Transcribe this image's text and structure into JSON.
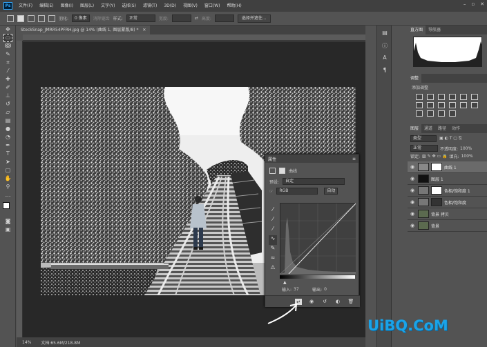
{
  "menubar": {
    "logo": "Ps",
    "items": [
      "文件(F)",
      "编辑(E)",
      "图像(I)",
      "图层(L)",
      "文字(Y)",
      "选择(S)",
      "滤镜(T)",
      "3D(D)",
      "视图(V)",
      "窗口(W)",
      "帮助(H)"
    ]
  },
  "options": {
    "feather_label": "羽化:",
    "feather_value": "0 像素",
    "antialias_label": "消除锯齿",
    "style_label": "样式:",
    "style_value": "正常",
    "width_label": "宽度:",
    "height_label": "高度:",
    "select_mask_button": "选择并遮住..."
  },
  "document": {
    "tab_title": "StockSnap_JMRR54PFRH.jpg @ 14% (曲线 1, 图层蒙版/8) *",
    "zoom": "14%",
    "doc_info": "文档:65.6M/218.8M"
  },
  "panels": {
    "top_tabs": [
      "直方图",
      "导航器"
    ],
    "adjust_tabs": [
      "调整"
    ],
    "adjust_hint": "添加调整",
    "layer_tabs": [
      "图层",
      "通道",
      "路径",
      "动作"
    ],
    "kind_label": "类型",
    "blend_mode": "正常",
    "opacity_label": "不透明度:",
    "opacity_value": "100%",
    "lock_label": "锁定:",
    "fill_label": "填充:",
    "fill_value": "100%",
    "layers": [
      {
        "name": "曲线 1",
        "selected": true
      },
      {
        "name": "图层 1",
        "selected": false
      },
      {
        "name": "色相/饱和度 1",
        "selected": false
      },
      {
        "name": "色相/饱和度",
        "selected": false
      },
      {
        "name": "背景 拷贝",
        "selected": false
      },
      {
        "name": "背景",
        "selected": false
      }
    ]
  },
  "properties": {
    "title": "属性",
    "subtitle": "曲线",
    "preset_label": "预设:",
    "preset_value": "自定",
    "channel_value": "RGB",
    "auto_button": "自动",
    "input_label": "输入:",
    "input_value": "37",
    "output_label": "输出:",
    "output_value": "0"
  },
  "watermark": "UiBQ.CoM"
}
